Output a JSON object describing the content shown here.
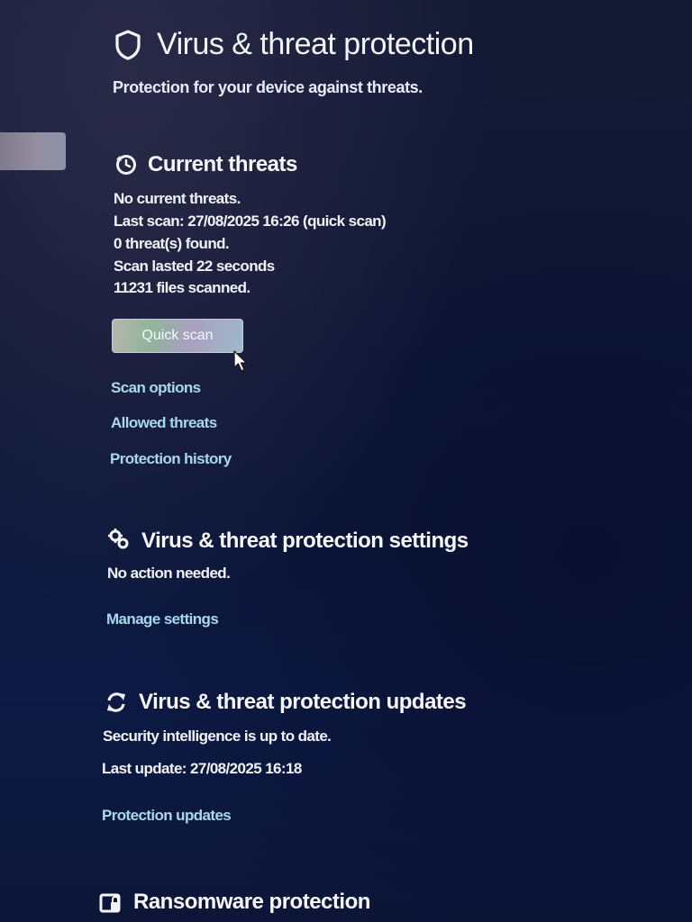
{
  "page": {
    "title": "Virus & threat protection",
    "subtitle": "Protection for your device against threats."
  },
  "current_threats": {
    "title": "Current threats",
    "lines": [
      "No current threats.",
      "Last scan: 27/08/2025 16:26 (quick scan)",
      "0 threat(s) found.",
      "Scan lasted 22 seconds",
      "11231 files scanned."
    ],
    "quick_scan_label": "Quick scan",
    "links": [
      "Scan options",
      "Allowed threats",
      "Protection history"
    ]
  },
  "settings": {
    "title": "Virus & threat protection settings",
    "status": "No action needed.",
    "link": "Manage settings"
  },
  "updates": {
    "title": "Virus & threat protection updates",
    "status": "Security intelligence is up to date.",
    "last_update": "Last update: 27/08/2025 16:18",
    "link": "Protection updates"
  },
  "ransomware": {
    "title": "Ransomware protection"
  },
  "icons": {
    "page": "shield-icon",
    "current_threats": "refresh-clock-icon",
    "settings": "gears-icon",
    "updates": "sync-arrows-icon",
    "ransomware": "ransomware-folder-icon",
    "pointer": "mouse-pointer-icon"
  },
  "colors": {
    "background": "#0f1836",
    "text": "#f2f4f8",
    "link": "#a9d8ec"
  }
}
